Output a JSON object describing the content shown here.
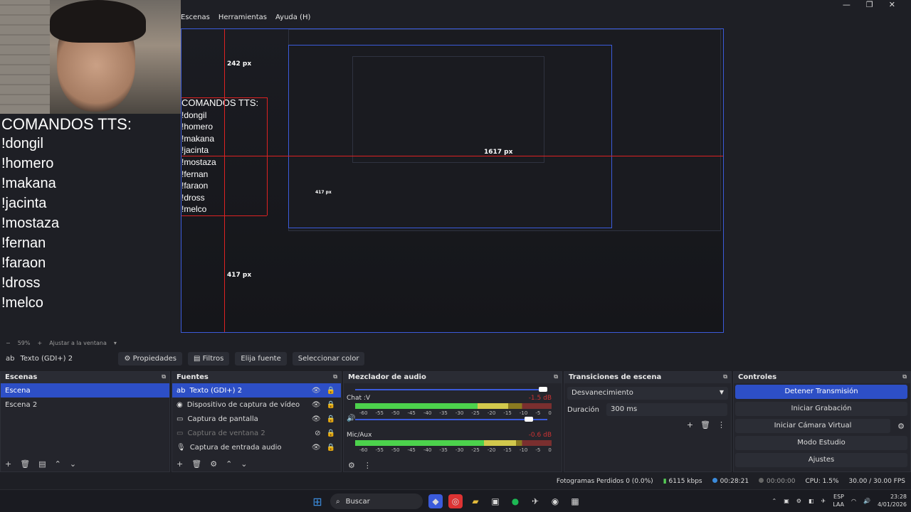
{
  "menu": [
    "Escenas",
    "Herramientas",
    "Ayuda (H)"
  ],
  "window_controls": [
    "—",
    "❐",
    "✕"
  ],
  "overlay": {
    "title": "COMANDOS TTS:",
    "commands": [
      "!dongil",
      "!homero",
      "!makana",
      "!jacinta",
      "!mostaza",
      "!fernan",
      "!faraon",
      "!dross",
      "!melco"
    ]
  },
  "preview": {
    "label_242": "242 px",
    "label_1617": "1617 px",
    "label_417": "417 px",
    "label_417_inner": "417 px"
  },
  "zoom": {
    "value": "59%",
    "fit_label": "Ajustar a la ventana"
  },
  "source_bar": {
    "selected_source": "Texto (GDI+) 2",
    "properties": "Propiedades",
    "filters": "Filtros",
    "choose_source": "Elija fuente",
    "select_color": "Seleccionar color"
  },
  "scenes": {
    "title": "Escenas",
    "items": [
      "Escena",
      "Escena 2"
    ]
  },
  "sources": {
    "title": "Fuentes",
    "items": [
      {
        "label": "Texto (GDI+) 2",
        "icon": "text-icon"
      },
      {
        "label": "Dispositivo de captura de vídeo",
        "icon": "camera-icon"
      },
      {
        "label": "Captura de pantalla",
        "icon": "monitor-icon"
      },
      {
        "label": "Captura de ventana 2",
        "icon": "window-icon"
      },
      {
        "label": "Captura de entrada audio",
        "icon": "mic-icon"
      }
    ]
  },
  "mixer": {
    "title": "Mezclador de audio",
    "channels": [
      {
        "name": "Chat :V",
        "db": "-1.5 dB",
        "level": 0.78
      },
      {
        "name": "Mic/Aux",
        "db": "-0.6 dB",
        "level": 0.82
      }
    ],
    "ticks": [
      "-60",
      "-55",
      "-50",
      "-45",
      "-40",
      "-35",
      "-30",
      "-25",
      "-20",
      "-15",
      "-10",
      "-5",
      "0"
    ]
  },
  "transitions": {
    "title": "Transiciones de escena",
    "selected": "Desvanecimiento",
    "duration_label": "Duración",
    "duration_value": "300 ms"
  },
  "controls": {
    "title": "Controles",
    "buttons": [
      "Detener Transmisión",
      "Iniciar Grabación",
      "Iniciar Cámara Virtual",
      "Modo Estudio",
      "Ajustes"
    ]
  },
  "status": {
    "dropped": "Fotogramas Perdidos 0 (0.0%)",
    "bitrate": "6115 kbps",
    "stream_time": "00:28:21",
    "rec_time": "00:00:00",
    "cpu": "CPU: 1.5%",
    "fps": "30.00 / 30.00 FPS"
  },
  "taskbar": {
    "search": "Buscar",
    "lang_top": "ESP",
    "lang_bottom": "LAA",
    "time": "23:28",
    "date": "4/01/2026"
  },
  "colors": {
    "accent": "#2d4fc6",
    "guide": "#dd2222"
  }
}
